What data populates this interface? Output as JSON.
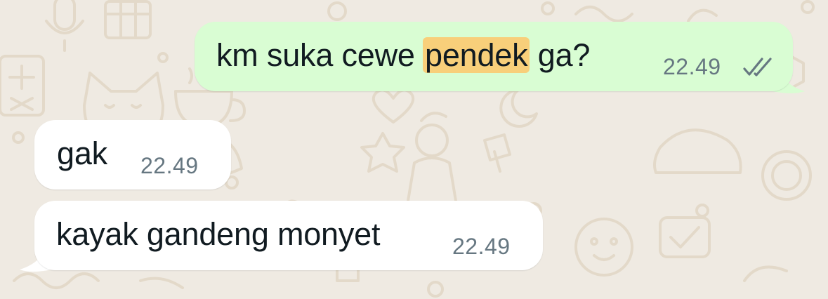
{
  "chat": {
    "messages": [
      {
        "direction": "outgoing",
        "text_before": "km suka cewe ",
        "highlight": "pendek",
        "text_after": " ga?",
        "time": "22.49",
        "status_icon": "double-check-icon"
      },
      {
        "direction": "incoming",
        "text": "gak",
        "time": "22.49"
      },
      {
        "direction": "incoming",
        "text": "kayak gandeng monyet",
        "time": "22.49"
      }
    ]
  },
  "colors": {
    "wallpaper": "#efeae2",
    "doodle": "#e2d8c8",
    "outgoing_bubble": "#d9fdd3",
    "incoming_bubble": "#ffffff",
    "search_highlight": "#f8cf7a",
    "timestamp": "#667781",
    "text": "#111b21"
  }
}
